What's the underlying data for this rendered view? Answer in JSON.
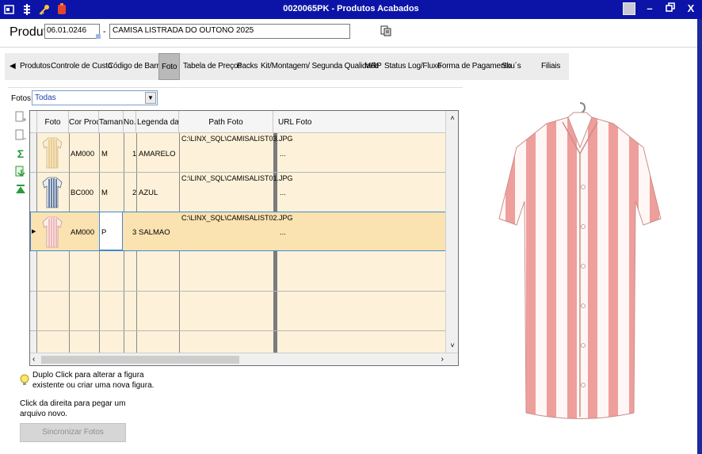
{
  "window": {
    "title": "0020065PK - Produtos Acabados"
  },
  "product": {
    "label": "Produto",
    "code": "06.01.0246",
    "dash": "-",
    "description": "CAMISA LISTRADA  DO OUTONO 2025"
  },
  "tabs": [
    {
      "label": "Produtos"
    },
    {
      "label": "Controle de Custo"
    },
    {
      "label": "Código de Barras"
    },
    {
      "label": "Foto",
      "active": true
    },
    {
      "label": "Tabela de Preços"
    },
    {
      "label": "Packs"
    },
    {
      "label": "Kit/Montagem/ Segunda Qualidade"
    },
    {
      "label": "MRP"
    },
    {
      "label": "Status Log/Fluxo"
    },
    {
      "label": "Forma de Pagamento"
    },
    {
      "label": "Sku´s"
    },
    {
      "label": "Filiais"
    }
  ],
  "filter": {
    "label": "Fotos:",
    "value": "Todas"
  },
  "grid": {
    "columns": [
      "Foto",
      "Cor Produto",
      "Tamanho",
      "No.",
      "Legenda da Foto",
      "Path Foto",
      "URL Foto"
    ],
    "rows": [
      {
        "cor": "AM000",
        "tamanho": "M",
        "no": "1",
        "legenda": "AMARELO",
        "path": "C:\\LINX_SQL\\CAMISALIST03.JPG",
        "url": "...",
        "shirt_color": "#e4c27c"
      },
      {
        "cor": "BC000",
        "tamanho": "M",
        "no": "2",
        "legenda": "AZUL",
        "path": "C:\\LINX_SQL\\CAMISALIST01.JPG",
        "url": "...",
        "shirt_color": "#3d5a84"
      },
      {
        "cor": "AM000",
        "tamanho": "P",
        "no": "3",
        "legenda": "SALMAO",
        "path": "C:\\LINX_SQL\\CAMISALIST02.JPG",
        "url": "...",
        "shirt_color": "#eaa3a3"
      }
    ]
  },
  "hints": {
    "double_click": "Duplo Click para alterar a figura existente ou criar uma nova figura.",
    "right_click": "Click da direita para pegar um arquivo novo."
  },
  "buttons": {
    "sync": "Sincronizar Fotos"
  },
  "colors": {
    "titlebar": "#0c14a8",
    "grid_body": "#fdf2d9",
    "selected_row": "#fbe2b1",
    "stripe": "#ee9e9b"
  }
}
